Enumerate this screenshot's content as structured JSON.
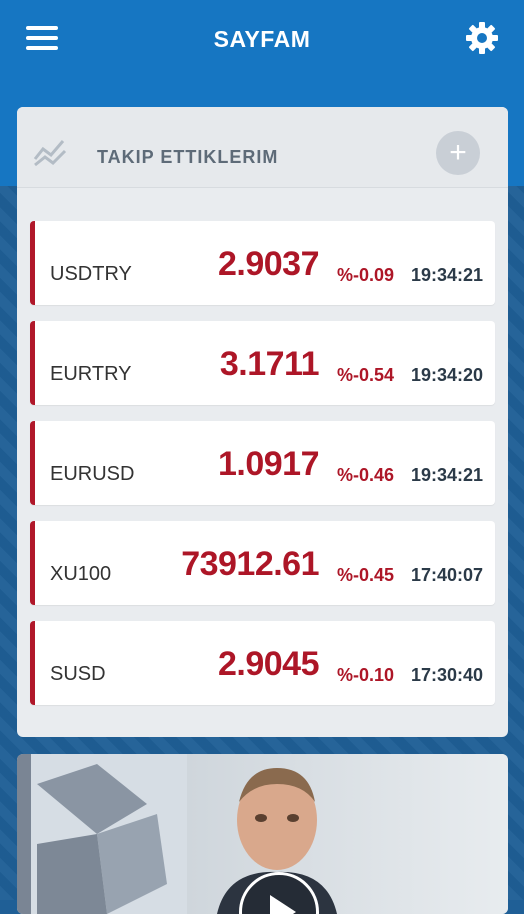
{
  "header": {
    "title": "SAYFAM"
  },
  "watchlist": {
    "title": "TAKIP ETTIKLERIM",
    "add_label": "+",
    "rows": [
      {
        "symbol": "USDTRY",
        "price": "2.9037",
        "change": "%-0.09",
        "time": "19:34:21"
      },
      {
        "symbol": "EURTRY",
        "price": "3.1711",
        "change": "%-0.54",
        "time": "19:34:20"
      },
      {
        "symbol": "EURUSD",
        "price": "1.0917",
        "change": "%-0.46",
        "time": "19:34:21"
      },
      {
        "symbol": "XU100",
        "price": "73912.61",
        "change": "%-0.45",
        "time": "17:40:07"
      },
      {
        "symbol": "SUSD",
        "price": "2.9045",
        "change": "%-0.10",
        "time": "17:30:40"
      }
    ]
  },
  "colors": {
    "header_blue": "#1676c2",
    "negative_red": "#ad1627",
    "panel_bg": "#e9ecef"
  },
  "icons": {
    "menu": "hamburger-icon",
    "settings": "gear-icon",
    "list": "trend-lines-icon",
    "add": "plus-icon",
    "video": "play-icon"
  }
}
